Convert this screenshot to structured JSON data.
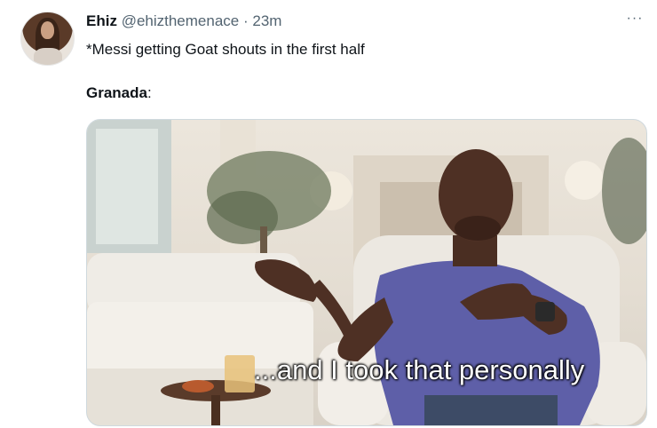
{
  "tweet": {
    "author_name": "Ehiz",
    "author_handle": "@ehizthemenace",
    "separator": "·",
    "time": "23m",
    "more_icon": "···",
    "text_line1": "*Messi getting Goat shouts in the first half",
    "text_line2_bold": "Granada",
    "text_line2_rest": ":"
  },
  "media": {
    "caption": "...and I took that personally"
  }
}
